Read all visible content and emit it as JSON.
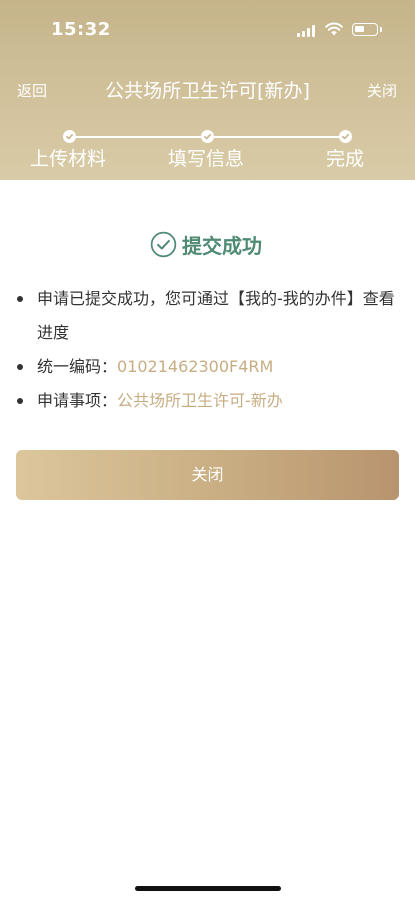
{
  "status_bar": {
    "time": "15:32"
  },
  "nav": {
    "back_label": "返回",
    "title": "公共场所卫生许可[新办]",
    "close_label": "关闭"
  },
  "steps": [
    {
      "label": "上传材料"
    },
    {
      "label": "填写信息"
    },
    {
      "label": "完成"
    }
  ],
  "result": {
    "title": "提交成功"
  },
  "info": {
    "message": "申请已提交成功，您可通过【我的-我的办件】查看进度",
    "code_label": "统一编码：",
    "code_value": "01021462300F4RM",
    "item_label": "申请事项：",
    "item_value": "公共场所卫生许可-新办"
  },
  "actions": {
    "close_button": "关闭"
  },
  "colors": {
    "header": "#c9b98f",
    "success": "#4f8a73",
    "highlight": "#c7ad83",
    "button_start": "#dcc69c",
    "button_end": "#b8946e"
  }
}
